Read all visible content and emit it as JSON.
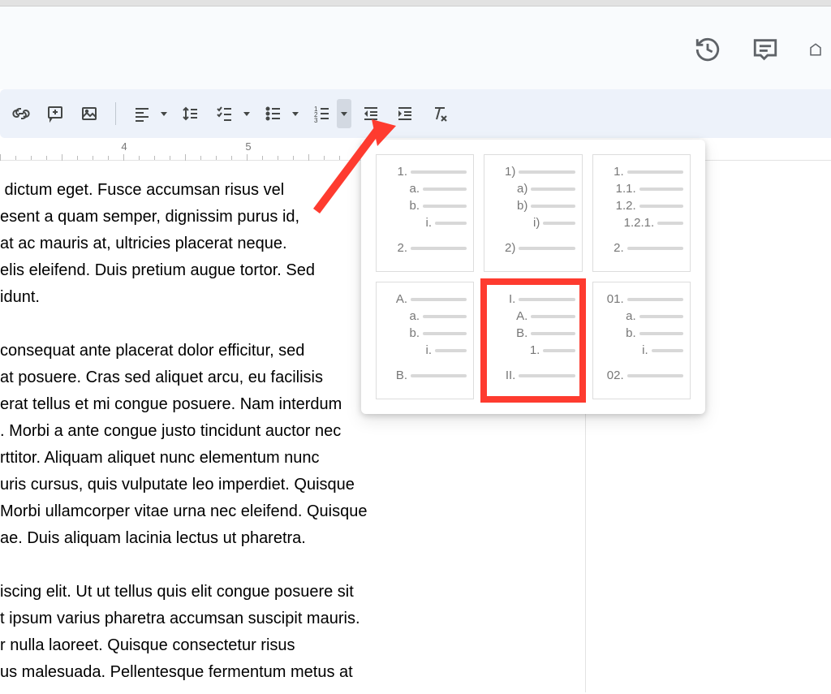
{
  "titlebar_icons": {
    "history": "history-icon",
    "comments": "comments-icon",
    "presentation": "presentation-partial-icon"
  },
  "toolbar": {
    "link_tooltip": "Insert link",
    "comment_tooltip": "Add comment",
    "image_tooltip": "Insert image",
    "align_tooltip": "Align",
    "linespacing_tooltip": "Line spacing",
    "checklist_tooltip": "Checklist",
    "bulleted_tooltip": "Bulleted list",
    "numbered_tooltip": "Numbered list",
    "decrease_indent_tooltip": "Decrease indent",
    "increase_indent_tooltip": "Increase indent",
    "clear_format_tooltip": "Clear formatting"
  },
  "ruler": {
    "labels": [
      "4",
      "5"
    ]
  },
  "document": {
    "paras": [
      " dictum eget. Fusce accumsan risus vel",
      "esent a quam semper, dignissim purus id,",
      "at ac mauris at, ultricies placerat neque.",
      "elis eleifend. Duis pretium augue tortor. Sed",
      "idunt.",
      "",
      "consequat ante placerat dolor efficitur, sed",
      "at posuere. Cras sed aliquet arcu, eu facilisis",
      "erat tellus et mi congue posuere. Nam interdum",
      ". Morbi a ante congue justo tincidunt auctor nec",
      "rttitor. Aliquam aliquet nunc elementum nunc",
      "uris cursus, quis vulputate leo imperdiet. Quisque",
      "Morbi ullamcorper vitae urna nec eleifend. Quisque",
      "ae. Duis aliquam lacinia lectus ut pharetra.",
      "",
      "iscing elit. Ut ut tellus quis elit congue posuere sit",
      "t ipsum varius pharetra accumsan suscipit mauris.",
      "r nulla laoreet. Quisque consectetur risus",
      "us malesuada. Pellentesque fermentum metus at"
    ]
  },
  "numbered_presets": [
    {
      "id": "preset-1-a-i",
      "rows": [
        {
          "lvl": 0,
          "lbl": "1."
        },
        {
          "lvl": 1,
          "lbl": "a."
        },
        {
          "lvl": 1,
          "lbl": "b."
        },
        {
          "lvl": 2,
          "lbl": "i."
        },
        {
          "lvl": 0,
          "lbl": "2."
        }
      ]
    },
    {
      "id": "preset-1paren",
      "rows": [
        {
          "lvl": 0,
          "lbl": "1)"
        },
        {
          "lvl": 1,
          "lbl": "a)"
        },
        {
          "lvl": 1,
          "lbl": "b)"
        },
        {
          "lvl": 2,
          "lbl": "i)"
        },
        {
          "lvl": 0,
          "lbl": "2)"
        }
      ]
    },
    {
      "id": "preset-legal",
      "rows": [
        {
          "lvl": 0,
          "lbl": "1."
        },
        {
          "lvl": 1,
          "lbl": "1.1."
        },
        {
          "lvl": 1,
          "lbl": "1.2."
        },
        {
          "lvl": 2,
          "lbl": "1.2.1."
        },
        {
          "lvl": 0,
          "lbl": "2."
        }
      ]
    },
    {
      "id": "preset-A-a-i",
      "rows": [
        {
          "lvl": 0,
          "lbl": "A."
        },
        {
          "lvl": 1,
          "lbl": "a."
        },
        {
          "lvl": 1,
          "lbl": "b."
        },
        {
          "lvl": 2,
          "lbl": "i."
        },
        {
          "lvl": 0,
          "lbl": "B."
        }
      ]
    },
    {
      "id": "preset-roman",
      "rows": [
        {
          "lvl": 0,
          "lbl": "I."
        },
        {
          "lvl": 1,
          "lbl": "A."
        },
        {
          "lvl": 1,
          "lbl": "B."
        },
        {
          "lvl": 2,
          "lbl": "1."
        },
        {
          "lvl": 0,
          "lbl": "II."
        }
      ],
      "highlight": true
    },
    {
      "id": "preset-01",
      "rows": [
        {
          "lvl": 0,
          "lbl": "01."
        },
        {
          "lvl": 1,
          "lbl": "a."
        },
        {
          "lvl": 1,
          "lbl": "b."
        },
        {
          "lvl": 2,
          "lbl": "i."
        },
        {
          "lvl": 0,
          "lbl": "02."
        }
      ]
    }
  ],
  "annotation": {
    "color": "#fe3b2f",
    "target": "numbered-list-dropdown"
  }
}
